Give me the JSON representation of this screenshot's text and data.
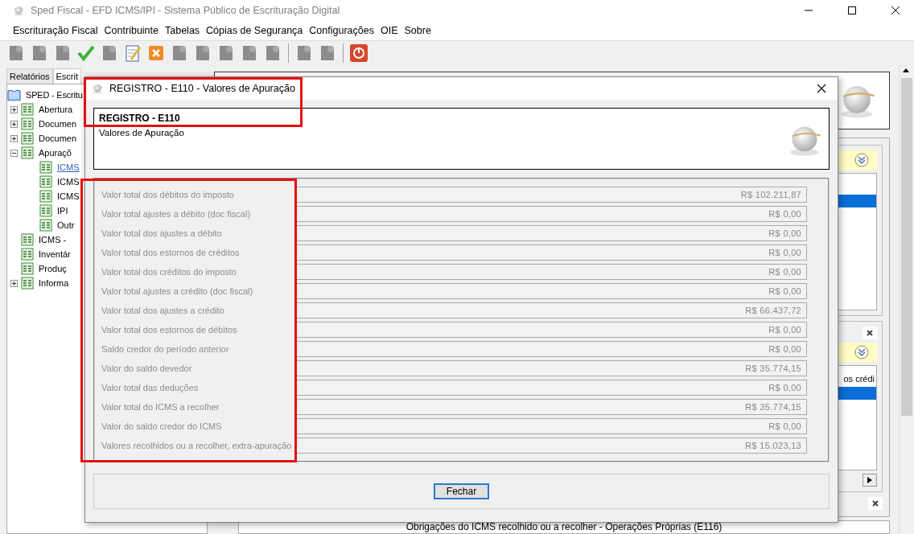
{
  "window": {
    "title": "Sped Fiscal - EFD ICMS/IPI - Sistema Público de Escrituração Digital"
  },
  "menu": [
    "Escrituração Fiscal",
    "Contribuinte",
    "Tabelas",
    "Cópias de Segurança",
    "Configurações",
    "OIE",
    "Sobre"
  ],
  "left_tabs": [
    {
      "label": "Relatórios",
      "selected": false
    },
    {
      "label": "Escrit",
      "selected": true
    }
  ],
  "tree": {
    "label": "SPED - Escritu",
    "children": [
      {
        "label": "Abertura",
        "expanded": false
      },
      {
        "label": "Documen",
        "expanded": false
      },
      {
        "label": "Documen",
        "expanded": false
      },
      {
        "label": "Apuraçõ",
        "expanded": true,
        "children": [
          {
            "label": "ICMS",
            "selected": true
          },
          {
            "label": "ICMS",
            "selected": false
          },
          {
            "label": "ICMS",
            "selected": false
          },
          {
            "label": "IPI",
            "selected": false
          },
          {
            "label": "Outr",
            "selected": false
          }
        ]
      },
      {
        "label": "ICMS -"
      },
      {
        "label": "Inventár"
      },
      {
        "label": "Produç"
      },
      {
        "label": "Informa",
        "expanded": false
      }
    ]
  },
  "right_panels": [
    {
      "rows": [
        {
          "selected": false
        },
        {
          "selected": true
        }
      ]
    },
    {
      "rows": [
        {
          "text": "os crédi",
          "selected": false
        },
        {
          "selected": true
        }
      ]
    }
  ],
  "bottom_caption": "Obrigações do ICMS recolhido ou a recolher - Operações Próprias (E116)",
  "dialog": {
    "title": "REGISTRO - E110 - Valores de Apuração",
    "header_title": "REGISTRO - E110",
    "header_subtitle": "Valores de Apuração",
    "fields": [
      {
        "label": "Valor total dos débitos do imposto",
        "value": "R$ 102.211,87"
      },
      {
        "label": "Valor total ajustes a débito (doc fiscal)",
        "value": "R$ 0,00"
      },
      {
        "label": "Valor total dos ajustes a débito",
        "value": "R$ 0,00"
      },
      {
        "label": "Valor total dos estornos de créditos",
        "value": "R$ 0,00"
      },
      {
        "label": "Valor total dos créditos do imposto",
        "value": "R$ 0,00"
      },
      {
        "label": "Valor total ajustes a crédito (doc fiscal)",
        "value": "R$ 0,00"
      },
      {
        "label": "Valor total dos ajustes a crédito",
        "value": "R$ 66.437,72"
      },
      {
        "label": "Valor total dos estornos de débitos",
        "value": "R$ 0,00"
      },
      {
        "label": "Saldo credor do período anterior",
        "value": "R$ 0,00"
      },
      {
        "label": "Valor do saldo devedor",
        "value": "R$ 35.774,15"
      },
      {
        "label": "Valor total das deduções",
        "value": "R$ 0,00"
      },
      {
        "label": "Valor total do ICMS a recolher",
        "value": "R$ 35.774,15"
      },
      {
        "label": "Valor do saldo credor do ICMS",
        "value": "R$ 0,00"
      },
      {
        "label": "Valores recolhidos ou a recolher, extra-apuração",
        "value": "R$ 15.023,13"
      }
    ],
    "button": "Fechar"
  }
}
